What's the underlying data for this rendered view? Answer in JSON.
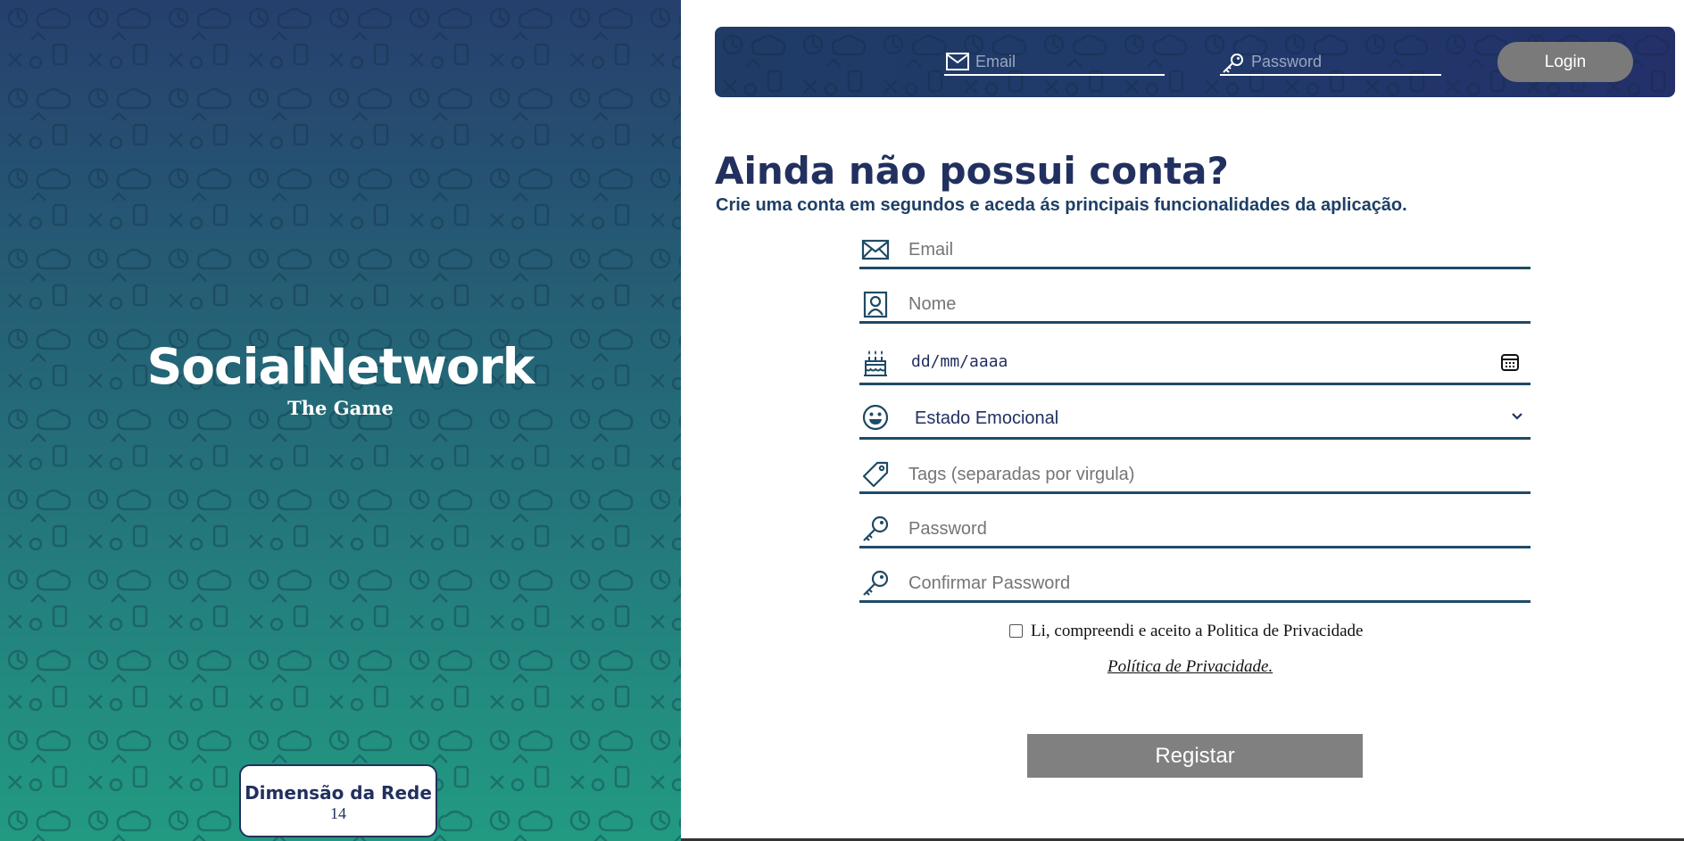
{
  "brand": {
    "title": "SocialNetwork",
    "subtitle": "The Game"
  },
  "network_size": {
    "label": "Dimensão da Rede",
    "value": "14"
  },
  "login_bar": {
    "email_placeholder": "Email",
    "password_placeholder": "Password",
    "login_label": "Login"
  },
  "register": {
    "title": "Ainda não possui conta?",
    "subtitle": "Crie uma conta em segundos e aceda ás principais funcionalidades da aplicação.",
    "email_placeholder": "Email",
    "name_placeholder": "Nome",
    "date_placeholder": "dd/mm/aaaa",
    "mood_selected": "Estado Emocional",
    "tags_placeholder": "Tags (separadas por virgula)",
    "password_placeholder": "Password",
    "confirm_placeholder": "Confirmar Password",
    "privacy_accept": "Li, compreendi e aceito a Politica de Privacidade",
    "privacy_link": "Política de Privacidade.",
    "register_label": "Registar"
  },
  "colors": {
    "navy": "#22305f",
    "teal_bottom": "#229a82",
    "field_line": "#1f4a66",
    "button_gray": "#808080"
  },
  "icons": [
    "mail-icon",
    "key-icon",
    "user-card-icon",
    "cake-icon",
    "calendar-icon",
    "smiley-icon",
    "chevron-down-icon",
    "tag-icon"
  ]
}
